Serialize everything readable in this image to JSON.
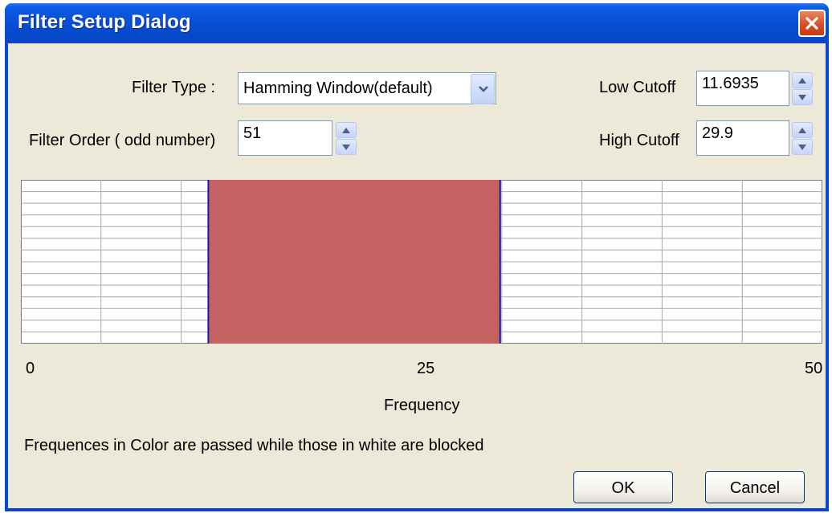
{
  "dialog": {
    "title": "Filter Setup Dialog"
  },
  "filter_type": {
    "label": "Filter Type :",
    "selected": "Hamming Window(default)"
  },
  "filter_order": {
    "label": "Filter Order ( odd number)",
    "value": "51"
  },
  "low_cutoff": {
    "label": "Low Cutoff",
    "value": "11.6935"
  },
  "high_cutoff": {
    "label": "High Cutoff",
    "value": "29.9"
  },
  "chart_data": {
    "type": "area",
    "xlabel": "Frequency",
    "ylabel": "",
    "xlim": [
      0,
      50
    ],
    "x_tick_labels": [
      "0",
      "25",
      "50"
    ],
    "passband": [
      11.6935,
      29.9
    ],
    "passband_color": "#c46262",
    "blocked_color": "#ffffff",
    "grid": true,
    "vertical_grid_lines": 10,
    "horizontal_grid_lines": 14
  },
  "caption": "Frequences in Color are passed while those in white are blocked",
  "buttons": {
    "ok": "OK",
    "cancel": "Cancel"
  },
  "colors": {
    "title_bar": "#0850d6",
    "dialog_bg": "#ece9d8",
    "close_button": "#d74b25"
  }
}
